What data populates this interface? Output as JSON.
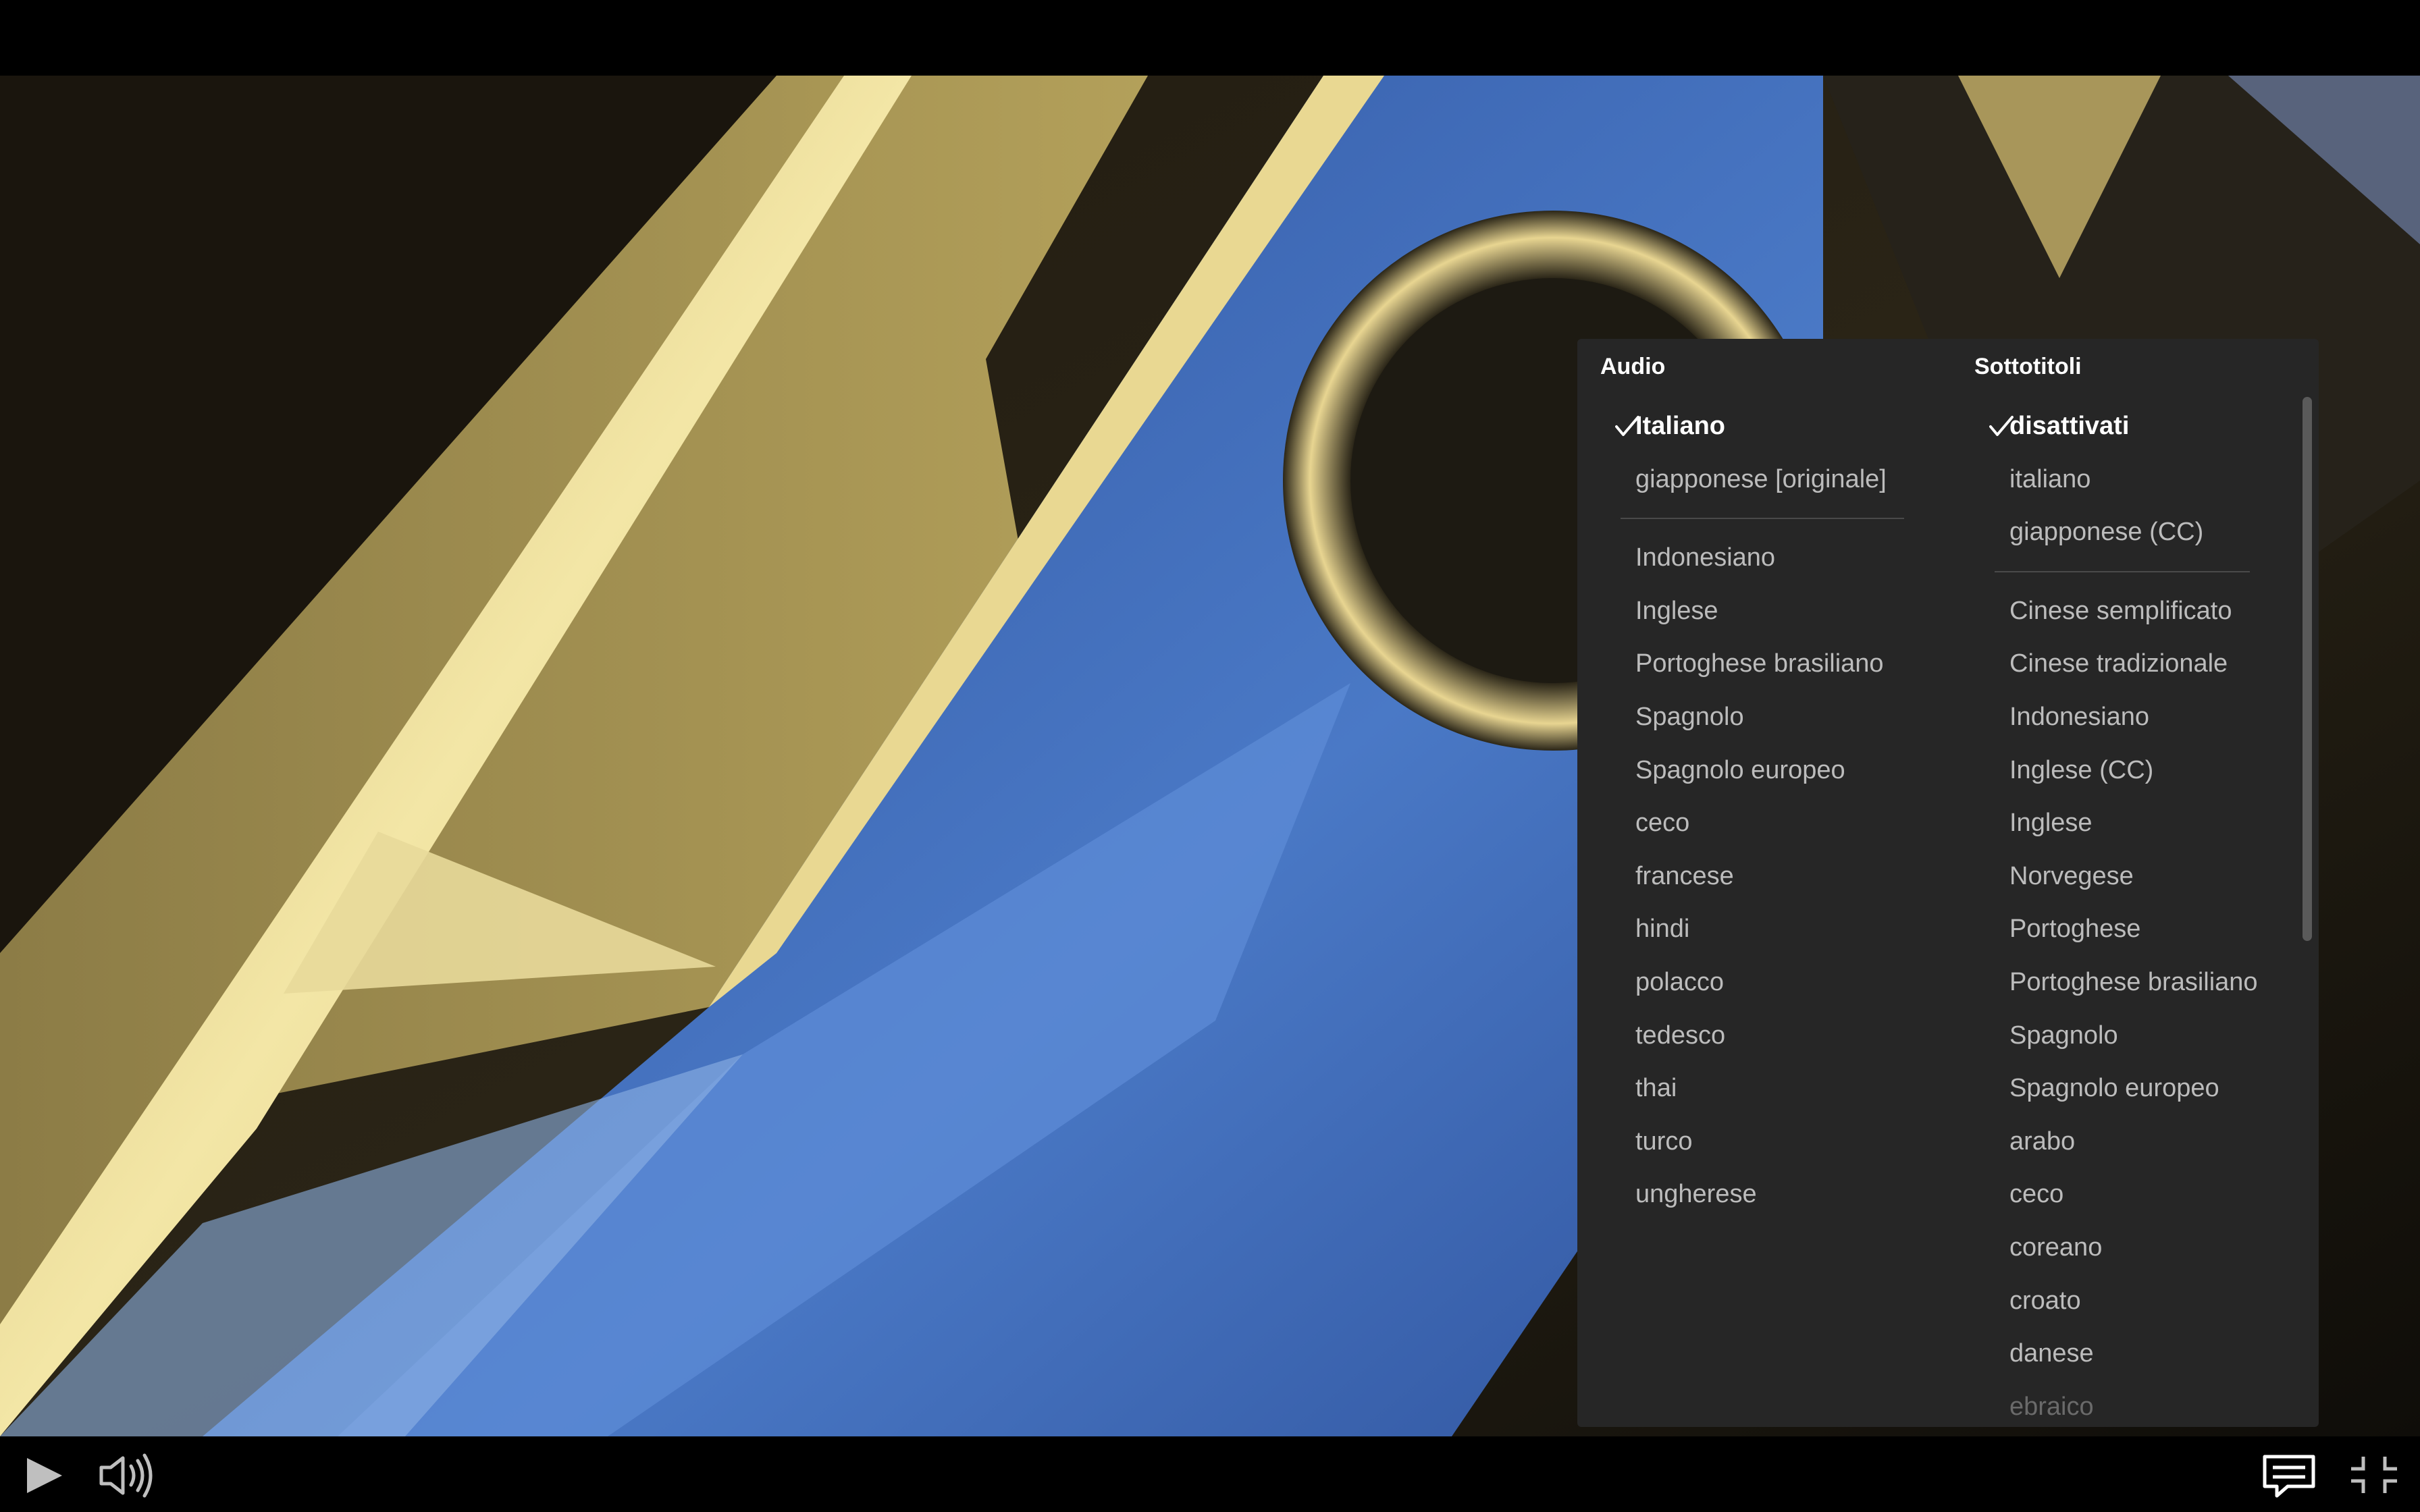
{
  "audio": {
    "header": "Audio",
    "items": [
      {
        "label": "Italiano",
        "selected": true
      },
      {
        "label": "giapponese [originale]",
        "selected": false
      },
      {
        "divider": true
      },
      {
        "label": "Indonesiano",
        "selected": false
      },
      {
        "label": "Inglese",
        "selected": false
      },
      {
        "label": "Portoghese brasiliano",
        "selected": false
      },
      {
        "label": "Spagnolo",
        "selected": false
      },
      {
        "label": "Spagnolo europeo",
        "selected": false
      },
      {
        "label": "ceco",
        "selected": false
      },
      {
        "label": "francese",
        "selected": false
      },
      {
        "label": "hindi",
        "selected": false
      },
      {
        "label": "polacco",
        "selected": false
      },
      {
        "label": "tedesco",
        "selected": false
      },
      {
        "label": "thai",
        "selected": false
      },
      {
        "label": "turco",
        "selected": false
      },
      {
        "label": "ungherese",
        "selected": false
      }
    ]
  },
  "subtitles": {
    "header": "Sottotitoli",
    "items": [
      {
        "label": "disattivati",
        "selected": true
      },
      {
        "label": "italiano",
        "selected": false
      },
      {
        "label": "giapponese (CC)",
        "selected": false
      },
      {
        "divider": true
      },
      {
        "label": "Cinese semplificato",
        "selected": false
      },
      {
        "label": "Cinese tradizionale",
        "selected": false
      },
      {
        "label": "Indonesiano",
        "selected": false
      },
      {
        "label": "Inglese (CC)",
        "selected": false
      },
      {
        "label": "Inglese",
        "selected": false
      },
      {
        "label": "Norvegese",
        "selected": false
      },
      {
        "label": "Portoghese",
        "selected": false
      },
      {
        "label": "Portoghese brasiliano",
        "selected": false
      },
      {
        "label": "Spagnolo",
        "selected": false
      },
      {
        "label": "Spagnolo europeo",
        "selected": false
      },
      {
        "label": "arabo",
        "selected": false
      },
      {
        "label": "ceco",
        "selected": false
      },
      {
        "label": "coreano",
        "selected": false
      },
      {
        "label": "croato",
        "selected": false
      },
      {
        "label": "danese",
        "selected": false
      },
      {
        "label": "ebraico",
        "selected": false,
        "faded": true
      }
    ]
  },
  "controls": {
    "play_icon": "play-icon",
    "volume_icon": "volume-icon",
    "subtitles_icon": "subtitles-icon",
    "exit_fullscreen_icon": "exit-fullscreen-icon"
  },
  "colors": {
    "panel_bg": "#262626",
    "item_text": "#bcbcbc",
    "selected_text": "#ffffff"
  }
}
